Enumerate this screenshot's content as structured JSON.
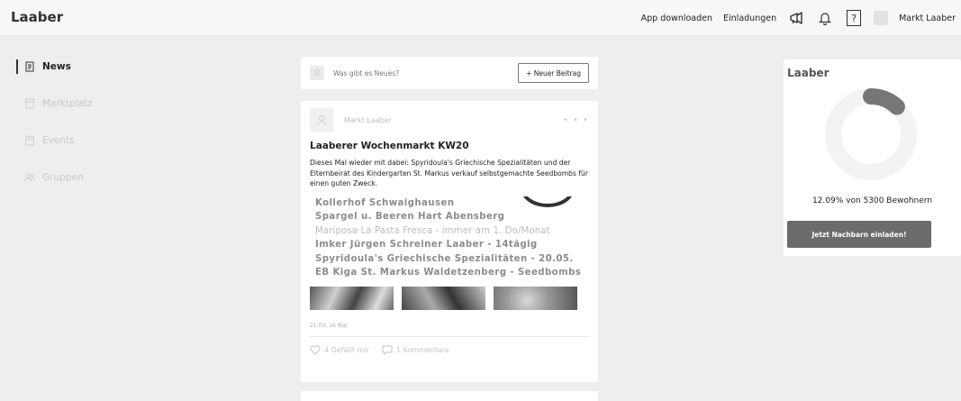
{
  "app": {
    "brand": "Laaber"
  },
  "topbar": {
    "download_label": "App downloaden",
    "invites_label": "Einladungen",
    "help_label": "?",
    "user_name": "Markt Laaber"
  },
  "sidebar": {
    "items": [
      {
        "label": "News",
        "icon": "newspaper-icon",
        "active": true
      },
      {
        "label": "Marktplatz",
        "icon": "store-icon",
        "active": false
      },
      {
        "label": "Events",
        "icon": "calendar-icon",
        "active": false
      },
      {
        "label": "Gruppen",
        "icon": "group-icon",
        "active": false
      }
    ]
  },
  "composer": {
    "placeholder": "Was gibt es Neues?",
    "new_post_label": "+ Neuer Beitrag"
  },
  "post": {
    "author": "Markt Laaber",
    "more_label": "• • •",
    "title": "Laaberer Wochenmarkt KW20",
    "body": "Dieses Mal wieder mit dabei: Spyridoula's Griechische Spezialitäten und der Elternbeirat des Kindergarten St. Markus verkauf selbstgemachte Seedbombs für einen guten Zweck.",
    "flyer_lines": [
      {
        "text": "Kollerhof Schwaighausen",
        "light": false
      },
      {
        "text": "Spargel u. Beeren Hart Abensberg",
        "light": false
      },
      {
        "text": "Mariposa La Pasta Fresca - immer am 1. Do/Monat",
        "light": true
      },
      {
        "text": "Imker Jürgen Schreiner Laaber - 14tägig",
        "light": false
      },
      {
        "text": "Spyridoula's Griechische Spezialitäten - 20.05.",
        "light": false
      },
      {
        "text": "EB Kiga St. Markus Waldetzenberg - Seedbombs",
        "light": false
      }
    ],
    "timestamp": "21:03, 16 Mai",
    "likes_label": "4 Gefällt mir",
    "comments_label": "1 Kommentare"
  },
  "stats": {
    "title": "Laaber",
    "percent": 12.09,
    "residents_text": "12.09% von 5300 Bewohnern",
    "invite_label": "Jetzt Nachbarn einladen!",
    "colors": {
      "track": "#f3f3f3",
      "fill": "#777777"
    }
  }
}
